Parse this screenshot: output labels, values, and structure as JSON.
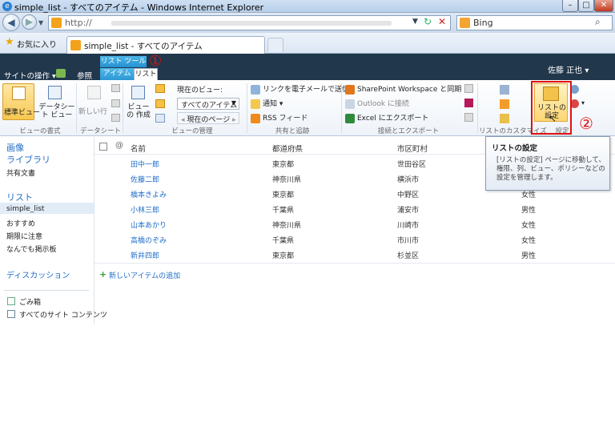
{
  "window": {
    "title": "simple_list - すべてのアイテム - Windows Internet Explorer",
    "buttons": {
      "minimize": "–",
      "maximize": "□",
      "close": "✕"
    }
  },
  "addressbar": {
    "url_prefix": "http://",
    "search_text": "Bing"
  },
  "favorites": {
    "label": "お気に入り",
    "tab_title": "simple_list - すべてのアイテム"
  },
  "sp_header": {
    "site_actions": "サイトの操作",
    "browse": "参照",
    "contextual_group": "リスト ツール",
    "tab_items": "アイテム",
    "tab_list": "リスト",
    "user": "佐藤 正也"
  },
  "ribbon": {
    "standard_view": "標準ビュー",
    "datasheet_view": "データシート ビュー",
    "group_format": "ビューの書式",
    "new_row": "新しい行",
    "group_datasheet": "データシート",
    "create_view": "ビューの 作成",
    "current_view_label": "現在のビュー:",
    "current_view_value": "すべてのアイテム",
    "current_page": "現在のページ",
    "group_manage_views": "ビューの管理",
    "email_link": "リンクを電子メールで送信",
    "alert": "通知",
    "rss": "RSS フィード",
    "group_share": "共有と追跡",
    "sp_workspace": "SharePoint Workspace と同期",
    "outlook": "Outlook に接続",
    "excel": "Excel にエクスポート",
    "group_connect": "接続とエクスポート",
    "group_customize": "リストのカスタマイズ",
    "list_settings": "リストの 設定",
    "group_settings": "設定"
  },
  "tooltip": {
    "title": "リストの設定",
    "body": "[リストの設定] ページに移動して、権限、列、ビュー、ポリシーなどの設定を管理します。"
  },
  "annotations": {
    "one": "①",
    "two": "②"
  },
  "leftnav": {
    "images": "画像",
    "libraries": "ライブラリ",
    "shared_docs": "共有文書",
    "lists": "リスト",
    "simple_list": "simple_list",
    "recommend": "おすすめ",
    "deadline": "期限に注意",
    "board": "なんでも掲示板",
    "discussions": "ディスカッション",
    "recycle": "ごみ箱",
    "all_content": "すべてのサイト コンテンツ"
  },
  "list": {
    "columns": [
      "名前",
      "都道府県",
      "市区町村"
    ],
    "rows": [
      {
        "name": "田中一郎",
        "pref": "東京都",
        "city": "世田谷区",
        "gender": ""
      },
      {
        "name": "佐藤二郎",
        "pref": "神奈川県",
        "city": "横浜市",
        "gender": ""
      },
      {
        "name": "橋本きよみ",
        "pref": "東京都",
        "city": "中野区",
        "gender": "女性"
      },
      {
        "name": "小林三郎",
        "pref": "千葉県",
        "city": "浦安市",
        "gender": "男性"
      },
      {
        "name": "山本あかり",
        "pref": "神奈川県",
        "city": "川崎市",
        "gender": "女性"
      },
      {
        "name": "高橋のぞみ",
        "pref": "千葉県",
        "city": "市川市",
        "gender": "女性"
      },
      {
        "name": "新井四郎",
        "pref": "東京都",
        "city": "杉並区",
        "gender": "男性"
      }
    ],
    "add_new": "新しいアイテムの追加"
  }
}
